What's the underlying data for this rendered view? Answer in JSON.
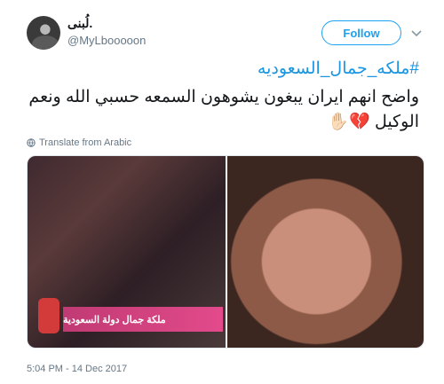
{
  "author": {
    "name": "لُبنى.",
    "handle": "@MyLbooooon"
  },
  "follow_label": "Follow",
  "tweet": {
    "hashtag": "#ملكه_جمال_السعوديه",
    "text": "واضح انهم ايران يبغون يشوهون السمعه حسبي الله ونعم الوكيل",
    "emojis": "💔✋🏻"
  },
  "translate_label": "Translate from Arabic",
  "media": {
    "caption": "ملكة جمال دولة السعودية"
  },
  "timestamp": "5:04 PM - 14 Dec 2017",
  "colors": {
    "accent": "#1da1f2",
    "text": "#14171a",
    "muted": "#657786"
  }
}
